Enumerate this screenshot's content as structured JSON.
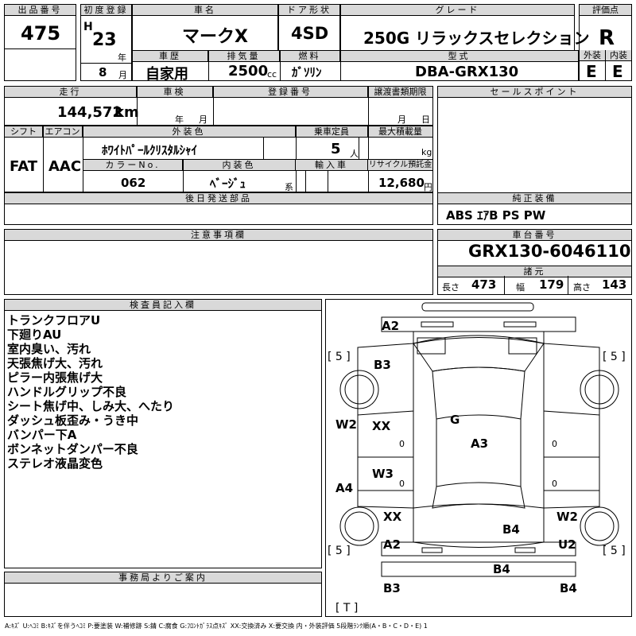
{
  "header": {
    "lot_label": "出品番号",
    "lot": "475",
    "reg_label": "初度登録",
    "era": "H",
    "year": "23",
    "year_unit": "年",
    "month": "8",
    "month_unit": "月",
    "name_label": "車名",
    "name": "マークX",
    "door_label": "ドア形状",
    "door": "4SD",
    "grade_label": "グレード",
    "grade": "250G リラックスセレクション",
    "score_label": "評価点",
    "score": "R",
    "history_label": "車歴",
    "history": "自家用",
    "disp_label": "排気量",
    "disp": "2500",
    "disp_unit": "cc",
    "fuel_label": "燃料",
    "fuel": "ｶﾞｿﾘﾝ",
    "model_label": "型式",
    "model": "DBA-GRX130",
    "ext_label": "外装",
    "ext": "E",
    "int_label": "内装",
    "int": "E"
  },
  "row2": {
    "km_label": "走行",
    "km": "144,572",
    "km_unit": "km",
    "inspect_label": "車検",
    "inspect_year_unit": "年",
    "inspect_month_unit": "月",
    "regno_label": "登録番号",
    "transfer_label": "譲渡書類期限",
    "transfer_month_unit": "月",
    "transfer_day_unit": "日",
    "sales_label": "セールスポイント"
  },
  "row3": {
    "shift_label": "シフト",
    "shift": "FAT",
    "ac_label": "エアコン",
    "ac": "AAC",
    "color_label": "外装色",
    "color": "ﾎﾜｲﾄﾊﾟｰﾙｸﾘｽﾀﾙｼｬｲ",
    "capacity_label": "乗車定員",
    "capacity": "5",
    "capacity_unit": "人",
    "load_label": "最大積載量",
    "load_unit": "kg",
    "colorno_label": "カラーNo.",
    "colorno": "062",
    "intcolor_label": "内装色",
    "intcolor": "ﾍﾞｰｼﾞｭ",
    "intcolor_suffix": "系",
    "import_label": "輸入車",
    "recycle_label": "リサイクル預託金",
    "recycle": "12,680",
    "recycle_unit": "円"
  },
  "later_label": "後日発送部品",
  "equip_label": "純正装備",
  "equip": "ABS ｴｱB PS PW",
  "caution_label": "注意事項欄",
  "chassis_label": "車台番号",
  "chassis": "GRX130-6046110",
  "specs_label": "諸元",
  "length_label": "長さ",
  "length": "473",
  "width_label": "幅",
  "width": "179",
  "height_label": "高さ",
  "height": "143",
  "inspector_label": "検査員記入欄",
  "notes": [
    "トランクフロアU",
    "下廻りAU",
    "室内臭い、汚れ",
    "天張焦げ大、汚れ",
    "ピラー内張焦げ大",
    "ハンドルグリップ不良",
    "シート焦げ中、しみ大、へたり",
    "ダッシュ板歪み・うき中",
    "バンパー下A",
    "ボンネットダンパー不良",
    "ステレオ液晶変色"
  ],
  "office_label": "事務局よりご案内",
  "diagram": {
    "labels": {
      "a2_top": "A2",
      "b3_top": "B3",
      "g": "G",
      "a3": "A3",
      "w2_left": "W2",
      "xx_left": "XX",
      "w3": "W3",
      "a4": "A4",
      "xx_left2": "XX",
      "b4_center": "B4",
      "w2_right": "W2",
      "a2_bottom": "A2",
      "u2": "U2",
      "b4_bottom": "B4",
      "b3_bottom": "B3",
      "b4_bottom_right": "B4",
      "zero": "0"
    },
    "tires": {
      "fl": "[ 5 ]",
      "fr": "[ 5 ]",
      "rl": "[ 5 ]",
      "rr": "[ 5 ]",
      "t": "[ T ]"
    }
  },
  "legend": "A:ｷｽﾞ U:ﾍｺﾐ B:ｷｽﾞを伴うﾍｺﾐ P:要塗装 W:補修跡 S:錆 C:腐食 G:ﾌﾛﾝﾄｶﾞﾗｽ点ｷｽﾞ XX:交換済み X:要交換 内・外装評価 5段階ﾗﾝｸ順(A・B・C・D・E) 1"
}
